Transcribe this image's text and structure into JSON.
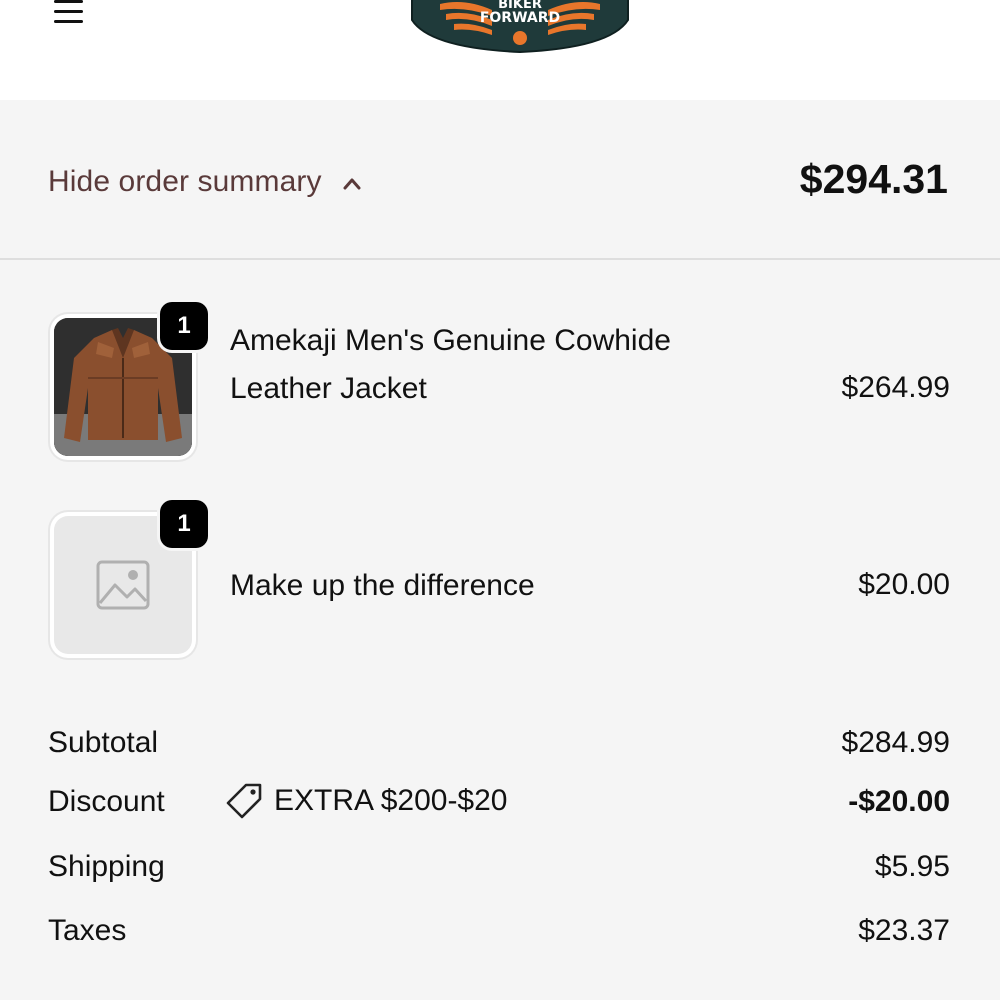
{
  "header": {
    "logo": {
      "text_top": "BIKER",
      "text_bottom": "FORWARD",
      "colors": {
        "badge": "#1f3a3a",
        "wings": "#e8762b",
        "text": "#ffffff"
      }
    },
    "menu_icon": "hamburger-menu-icon"
  },
  "summary": {
    "toggle_label": "Hide order summary",
    "toggle_icon": "chevron-up-icon",
    "total": "$294.31"
  },
  "items": [
    {
      "quantity": "1",
      "name": "Amekaji Men's Genuine Cowhide Leather Jacket",
      "price": "$264.99",
      "image": "leather-jacket-image"
    },
    {
      "quantity": "1",
      "name": "Make up the difference",
      "price": "$20.00",
      "image": "image-placeholder-icon"
    }
  ],
  "totals": {
    "subtotal": {
      "label": "Subtotal",
      "value": "$284.99"
    },
    "discount": {
      "label": "Discount",
      "code": "EXTRA $200-$20",
      "value": "-$20.00",
      "icon": "tag-icon"
    },
    "shipping": {
      "label": "Shipping",
      "value": "$5.95"
    },
    "taxes": {
      "label": "Taxes",
      "value": "$23.37"
    }
  },
  "colors": {
    "toggle_text": "#5a3a3a",
    "panel_bg": "#f5f5f5",
    "badge_bg": "#000000"
  }
}
